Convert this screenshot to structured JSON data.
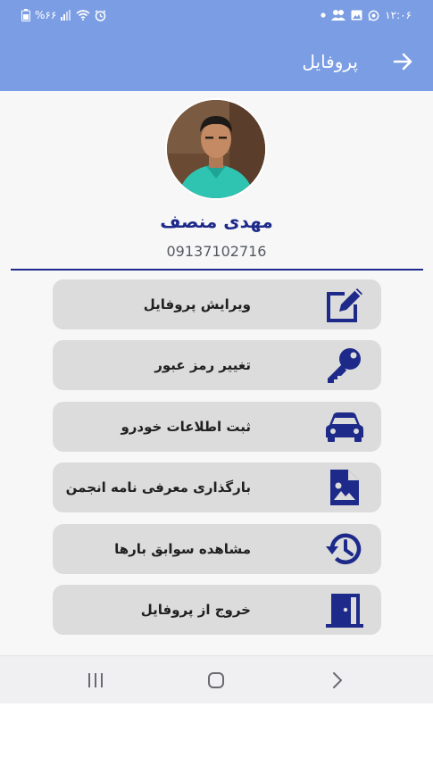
{
  "status_bar": {
    "battery_text": "%۶۶",
    "time": "۱۲:۰۶"
  },
  "header": {
    "title": "پروفایل"
  },
  "profile": {
    "name": "مهدی منصف",
    "phone": "09137102716"
  },
  "menu": [
    {
      "label": "ویرایش پروفایل",
      "icon": "edit-icon"
    },
    {
      "label": "تغییر رمز عبور",
      "icon": "key-icon"
    },
    {
      "label": "ثبت اطلاعات خودرو",
      "icon": "car-icon"
    },
    {
      "label": "بارگذاری معرفی نامه انجمن",
      "icon": "image-file-icon"
    },
    {
      "label": "مشاهده سوابق بارها",
      "icon": "history-icon"
    },
    {
      "label": "خروج از پروفایل",
      "icon": "exit-door-icon"
    }
  ],
  "colors": {
    "primary": "#7b9de3",
    "accent": "#1d2a8a",
    "button_bg": "#dcdcdc"
  }
}
